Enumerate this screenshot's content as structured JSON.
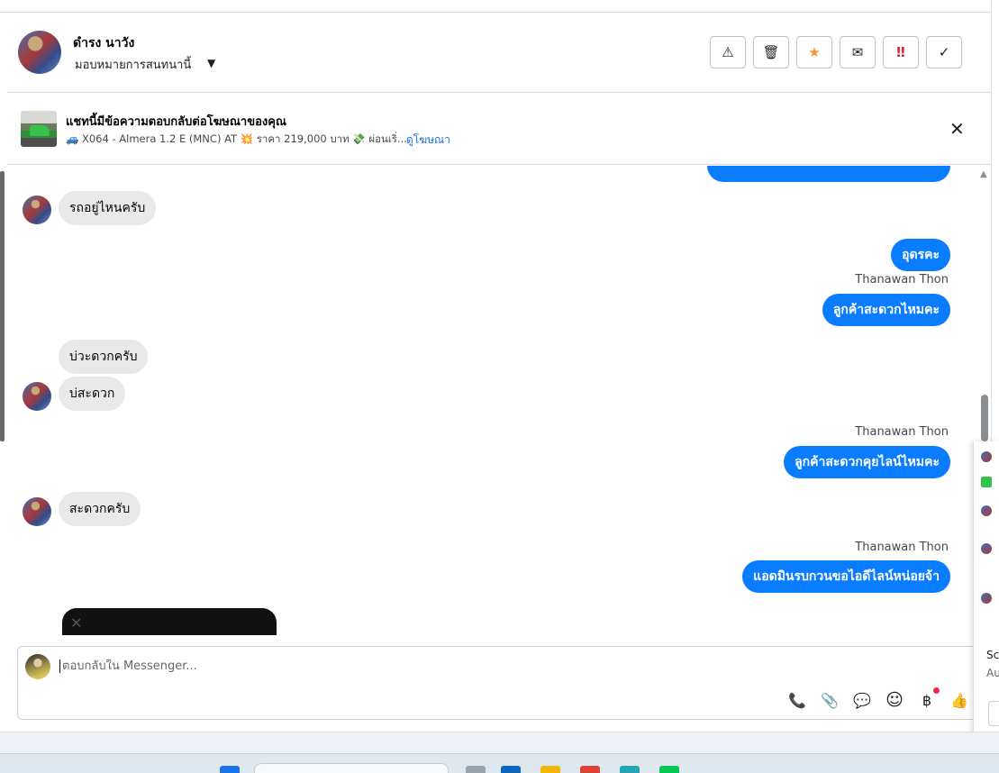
{
  "header": {
    "contact_name": "ดำรง นาวัง",
    "assign_label": "มอบหมายการสนทนานี้",
    "actions": [
      {
        "name": "report-spam-button",
        "icon": "warning-icon",
        "glyph": "⚠"
      },
      {
        "name": "delete-button",
        "icon": "trash-icon",
        "glyph": "🗑"
      },
      {
        "name": "star-button",
        "icon": "star-icon",
        "glyph": "★",
        "color": "#f7923b"
      },
      {
        "name": "mark-unread-button",
        "icon": "envelope-icon",
        "glyph": "✉"
      },
      {
        "name": "follow-up-button",
        "icon": "exclamation-icon",
        "glyph": "‼",
        "color": "#e41e3f"
      },
      {
        "name": "mark-done-button",
        "icon": "check-icon",
        "glyph": "✓"
      }
    ]
  },
  "ad_banner": {
    "title": "แชทนี้มีข้อความตอบกลับต่อโฆษณาของคุณ",
    "description": "🚙 X064 - Almera 1.2 E (MNC) AT 💥 ราคา 219,000 บาท 💸 ผ่อนเริ่...",
    "link": "ดูโฆษณา",
    "close_glyph": "✕"
  },
  "messages": [
    {
      "dir": "in",
      "text": "รถอยู่ไหนครับ"
    },
    {
      "dir": "out",
      "text": "อุดรคะ"
    },
    {
      "dir": "out",
      "sender": "Thanawan Thon",
      "text": "ลูกค้าสะดวกไหมคะ"
    },
    {
      "dir": "in",
      "text": "บ่วะดวกครับ"
    },
    {
      "dir": "in",
      "text": "บ่สะดวก"
    },
    {
      "dir": "out",
      "sender": "Thanawan Thon",
      "text": "ลูกค้าสะดวกคุยไลน์ไหมคะ"
    },
    {
      "dir": "in",
      "text": "สะดวกครับ"
    },
    {
      "dir": "out",
      "sender": "Thanawan Thon",
      "text": "แอดมินรบกวนขอไอดีไลน์หน่อยจ้า"
    }
  ],
  "composer": {
    "placeholder": "ตอบกลับใน Messenger...",
    "tools": [
      {
        "name": "call-icon",
        "glyph": "📞"
      },
      {
        "name": "attachment-icon",
        "glyph": "📎"
      },
      {
        "name": "saved-replies-icon",
        "glyph": "💬"
      },
      {
        "name": "emoji-icon",
        "glyph": "☺"
      },
      {
        "name": "payment-icon",
        "glyph": "฿"
      },
      {
        "name": "like-icon",
        "glyph": "👍"
      }
    ]
  },
  "side_panel": {
    "text_1": "Sc",
    "text_2": "Au"
  }
}
